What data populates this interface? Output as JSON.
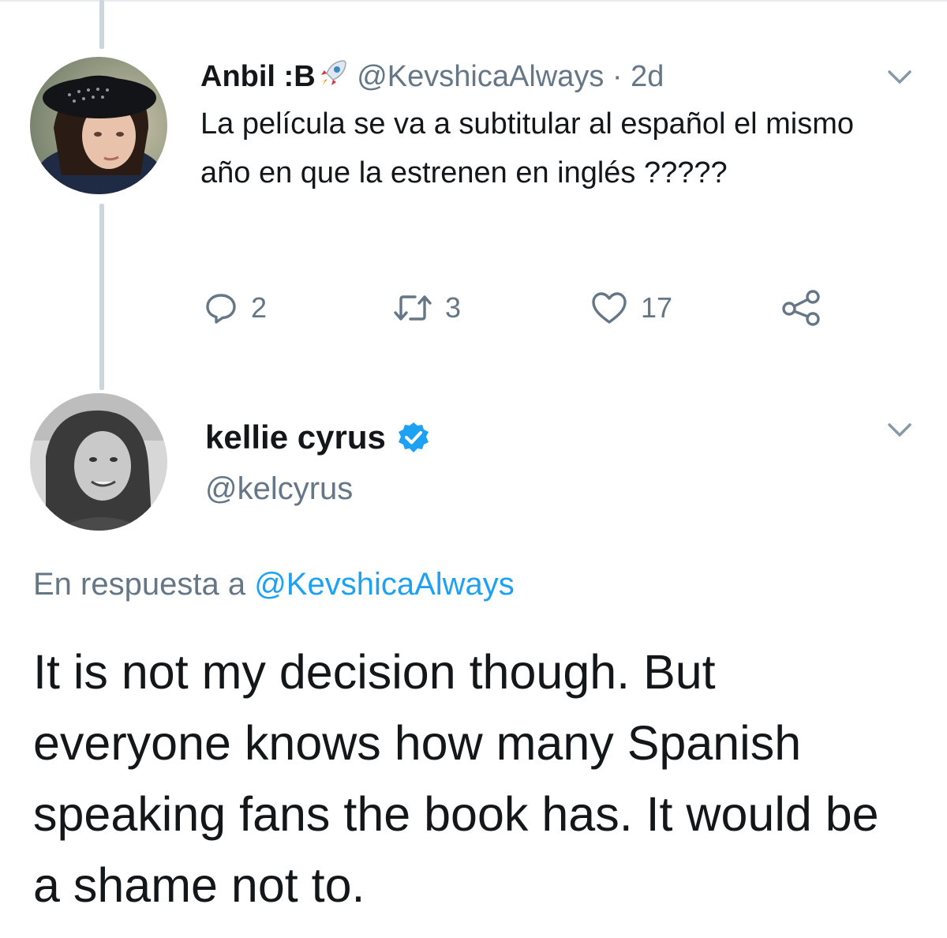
{
  "tweet_parent": {
    "display_name": "Anbil :B",
    "emoji": "rocket-icon",
    "handle": "@KevshicaAlways",
    "separator": "·",
    "time": "2d",
    "text": "La película se va a subtitular al español el mismo año en que la estrenen en inglés ?????",
    "actions": {
      "reply_count": "2",
      "retweet_count": "3",
      "like_count": "17"
    }
  },
  "tweet_reply": {
    "display_name": "kellie cyrus",
    "verified": true,
    "handle": "@kelcyrus",
    "reply_prefix": "En respuesta a",
    "reply_mention": "@KevshicaAlways",
    "text": "It is not my decision though. But everyone knows how many Spanish speaking fans the book has. It would be a shame not to."
  },
  "colors": {
    "accent": "#1da1f2",
    "secondary_text": "#657786",
    "primary_text": "#14171a",
    "thread_line": "#ccd6dd"
  }
}
